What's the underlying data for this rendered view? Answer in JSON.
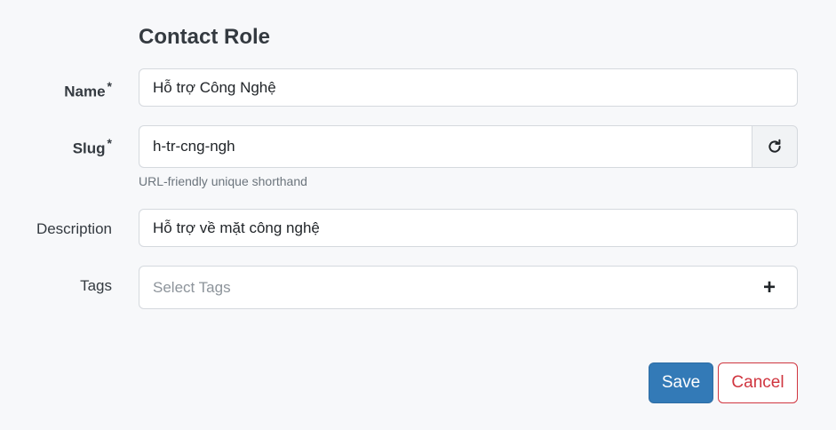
{
  "form": {
    "title": "Contact Role",
    "name": {
      "label": "Name",
      "required_mark": "*",
      "value": "Hỗ trợ Công Nghệ"
    },
    "slug": {
      "label": "Slug",
      "required_mark": "*",
      "value": "h-tr-cng-ngh",
      "help": "URL-friendly unique shorthand",
      "regenerate_icon": "refresh-icon"
    },
    "description": {
      "label": "Description",
      "value": "Hỗ trợ về mặt công nghệ"
    },
    "tags": {
      "label": "Tags",
      "placeholder": "Select Tags",
      "add_icon": "+"
    }
  },
  "actions": {
    "save": "Save",
    "cancel": "Cancel"
  },
  "colors": {
    "primary": "#337ab7",
    "danger": "#d0353f"
  }
}
